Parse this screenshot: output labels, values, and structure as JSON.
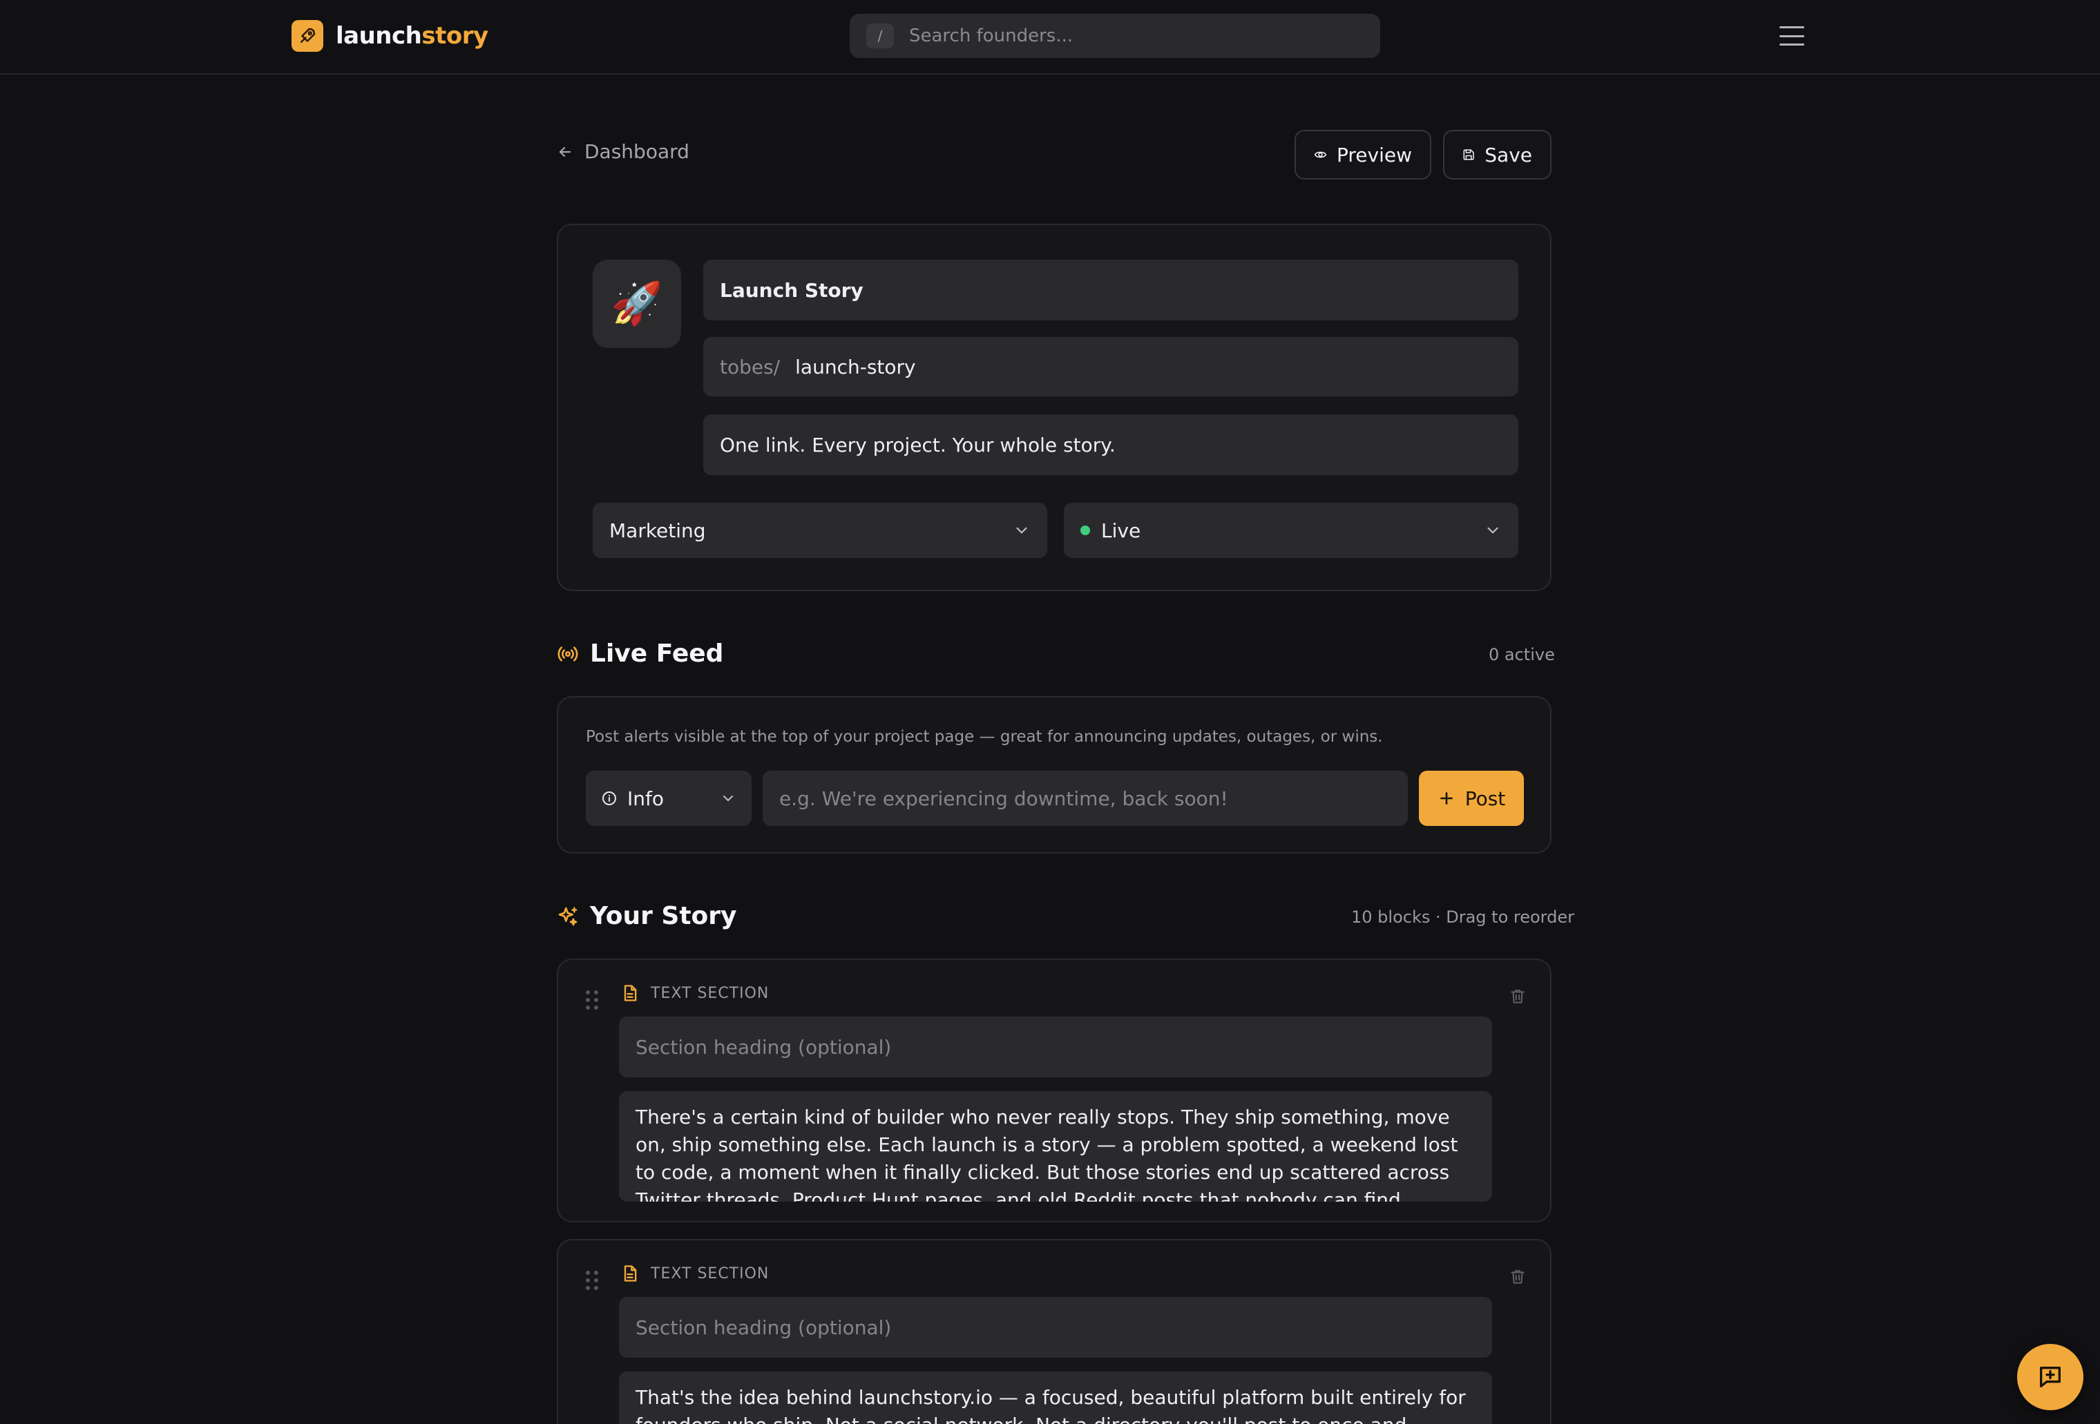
{
  "app": {
    "logo_part1": "launch",
    "logo_part2": "story",
    "search_shortcut": "/",
    "search_placeholder": "Search founders..."
  },
  "header": {
    "back_label": "Dashboard",
    "preview_label": "Preview",
    "save_label": "Save"
  },
  "project": {
    "emoji": "🚀",
    "title": "Launch Story",
    "slug_prefix": "tobes/",
    "slug": "launch-story",
    "tagline": "One link. Every project. Your whole story.",
    "category": "Marketing",
    "status": "Live",
    "status_color": "#3ecf7e"
  },
  "live_feed": {
    "title": "Live Feed",
    "count": "0 active",
    "description": "Post alerts visible at the top of your project page — great for announcing updates, outages, or wins.",
    "type": "Info",
    "placeholder": "e.g. We're experiencing downtime, back soon!",
    "post_label": "Post"
  },
  "story": {
    "title": "Your Story",
    "meta": "10 blocks · Drag to reorder",
    "blocks": [
      {
        "type_label": "TEXT SECTION",
        "heading_placeholder": "Section heading (optional)",
        "body": "There's a certain kind of builder who never really stops. They ship something, move on, ship something else. Each launch is a story — a problem spotted, a weekend lost to code, a moment when it finally clicked. But those stories end up scattered across Twitter threads, Product Hunt pages, and old Reddit posts that nobody can find anymore. We thought they"
      },
      {
        "type_label": "TEXT SECTION",
        "heading_placeholder": "Section heading (optional)",
        "body": "That's the idea behind launchstory.io — a focused, beautiful platform built entirely for founders who ship. Not a social network. Not a directory you'll post to once and forget. A real"
      }
    ]
  },
  "colors": {
    "accent": "#f2a93b",
    "background": "#111113",
    "surface": "#2a2a2d"
  },
  "icons": {
    "logo": "rocket-pen-icon",
    "back": "arrow-left-icon",
    "preview": "eye-icon",
    "save": "floppy-disk-icon",
    "menu": "hamburger-icon",
    "chevron": "chevron-down-icon",
    "live_feed": "broadcast-icon",
    "story": "sparkles-icon",
    "info": "info-circle-icon",
    "plus": "plus-icon",
    "block": "document-icon",
    "drag": "drag-handle-icon",
    "delete": "trash-icon",
    "feedback": "message-plus-icon"
  }
}
